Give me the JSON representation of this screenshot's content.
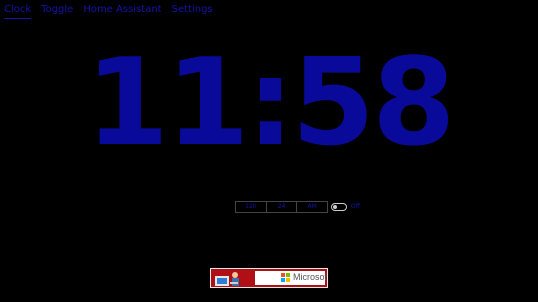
{
  "nav": {
    "tabs": [
      {
        "label": "Clock"
      },
      {
        "label": "Toggle"
      },
      {
        "label": "Home Assistant"
      },
      {
        "label": "Settings"
      }
    ]
  },
  "clock": {
    "time": "11:58"
  },
  "format": {
    "options": [
      "12h",
      "24",
      "AM"
    ]
  },
  "toggle": {
    "label": "Off",
    "state": false
  },
  "ad": {
    "brand": "Microsoft"
  },
  "colors": {
    "background": "#000000",
    "clock": "#0a0a9a",
    "accent": "#1414a8",
    "ad_red": "#b00f16",
    "ms_red": "#f25022",
    "ms_green": "#7fba00",
    "ms_blue": "#00a4ef",
    "ms_yellow": "#ffb900"
  }
}
